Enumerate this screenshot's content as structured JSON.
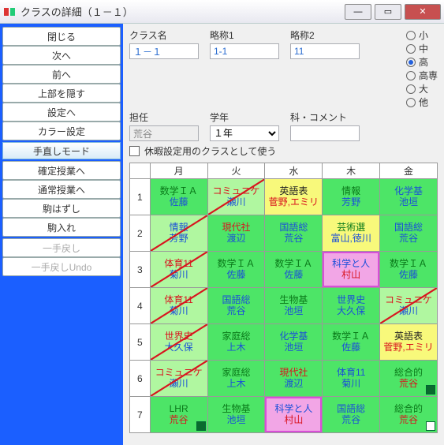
{
  "window": {
    "title": "クラスの詳細（１－１）"
  },
  "sidebar": {
    "buttons": [
      "閉じる",
      "次へ",
      "前へ",
      "上部を隠す",
      "設定へ",
      "カラー設定"
    ],
    "section": "手直しモード",
    "buttons2": [
      "確定授業へ",
      "通常授業へ",
      "駒はずし",
      "駒入れ"
    ],
    "disabled": [
      "一手戻し",
      "一手戻しUndo"
    ]
  },
  "form": {
    "l_class": "クラス名",
    "v_class": "１－１",
    "l_abbr1": "略称1",
    "v_abbr1": "1-1",
    "l_abbr2": "略称2",
    "v_abbr2": "11",
    "l_tannin": "担任",
    "v_tannin": "荒谷",
    "l_grade": "学年",
    "v_grade": "１年",
    "l_ka": "科・コメント",
    "v_ka": ""
  },
  "radios": [
    "小",
    "中",
    "高",
    "高専",
    "大",
    "他"
  ],
  "radio_sel": 2,
  "checkbox": "休暇設定用のクラスとして使う",
  "days": [
    "月",
    "火",
    "水",
    "木",
    "金"
  ],
  "rows": [
    "1",
    "2",
    "3",
    "4",
    "5",
    "6",
    "7"
  ],
  "cells": [
    [
      {
        "s": "数学ＩＡ",
        "t": "佐藤",
        "bg": "g",
        "sc": "subj-g",
        "tc": "tch-b"
      },
      {
        "s": "コミュニケ",
        "t": "瀬川",
        "bg": "lg",
        "sc": "subj-r",
        "tc": "tch-b",
        "d": 1
      },
      {
        "s": "英語表",
        "t": "菅野,エミリ",
        "bg": "y",
        "sc": "subj-k",
        "tc": "tch-r"
      },
      {
        "s": "情報",
        "t": "芳野",
        "bg": "g",
        "sc": "subj-g",
        "tc": "tch-b"
      },
      {
        "s": "化学基",
        "t": "池垣",
        "bg": "g",
        "sc": "subj-b",
        "tc": "tch-b"
      }
    ],
    [
      {
        "s": "情報",
        "t": "芳野",
        "bg": "lg",
        "sc": "subj-b",
        "tc": "tch-b",
        "d": 1
      },
      {
        "s": "現代社",
        "t": "渡辺",
        "bg": "g",
        "sc": "subj-r",
        "tc": "tch-b"
      },
      {
        "s": "国語総",
        "t": "荒谷",
        "bg": "g",
        "sc": "subj-b",
        "tc": "tch-b"
      },
      {
        "s": "芸術選",
        "t": "富山,徳川",
        "bg": "y",
        "sc": "subj-g",
        "tc": "tch-b"
      },
      {
        "s": "国語総",
        "t": "荒谷",
        "bg": "g",
        "sc": "subj-b",
        "tc": "tch-b"
      }
    ],
    [
      {
        "s": "体育11",
        "t": "菊川",
        "bg": "lg",
        "sc": "subj-r",
        "tc": "tch-b",
        "d": 1
      },
      {
        "s": "数学ＩＡ",
        "t": "佐藤",
        "bg": "g",
        "sc": "subj-g",
        "tc": "tch-b"
      },
      {
        "s": "数学ＩＡ",
        "t": "佐藤",
        "bg": "g",
        "sc": "subj-g",
        "tc": "tch-b"
      },
      {
        "s": "科学と人",
        "t": "村山",
        "bg": "p",
        "sc": "subj-b",
        "tc": "tch-r",
        "pb": 1
      },
      {
        "s": "数学ＩＡ",
        "t": "佐藤",
        "bg": "g",
        "sc": "subj-g",
        "tc": "tch-b"
      }
    ],
    [
      {
        "s": "体育11",
        "t": "菊川",
        "bg": "lg",
        "sc": "subj-r",
        "tc": "tch-b",
        "d": 1
      },
      {
        "s": "国語総",
        "t": "荒谷",
        "bg": "g",
        "sc": "subj-b",
        "tc": "tch-b"
      },
      {
        "s": "生物基",
        "t": "池垣",
        "bg": "g",
        "sc": "subj-g",
        "tc": "tch-b"
      },
      {
        "s": "世界史",
        "t": "大久保",
        "bg": "g",
        "sc": "subj-b",
        "tc": "tch-b"
      },
      {
        "s": "コミュニケ",
        "t": "瀬川",
        "bg": "lg",
        "sc": "subj-r",
        "tc": "tch-b",
        "d": 1
      }
    ],
    [
      {
        "s": "世界史",
        "t": "大久保",
        "bg": "lg",
        "sc": "subj-r",
        "tc": "tch-b",
        "d": 1
      },
      {
        "s": "家庭総",
        "t": "上木",
        "bg": "g",
        "sc": "subj-g",
        "tc": "tch-b"
      },
      {
        "s": "化学基",
        "t": "池垣",
        "bg": "g",
        "sc": "subj-b",
        "tc": "tch-b"
      },
      {
        "s": "数学ＩＡ",
        "t": "佐藤",
        "bg": "g",
        "sc": "subj-g",
        "tc": "tch-b"
      },
      {
        "s": "英語表",
        "t": "菅野,エミリ",
        "bg": "y",
        "sc": "subj-k",
        "tc": "tch-r"
      }
    ],
    [
      {
        "s": "コミュニケ",
        "t": "瀬川",
        "bg": "lg",
        "sc": "subj-r",
        "tc": "tch-b",
        "d": 1
      },
      {
        "s": "家庭総",
        "t": "上木",
        "bg": "g",
        "sc": "subj-g",
        "tc": "tch-b"
      },
      {
        "s": "現代社",
        "t": "渡辺",
        "bg": "g",
        "sc": "subj-r",
        "tc": "tch-b"
      },
      {
        "s": "体育11",
        "t": "菊川",
        "bg": "g",
        "sc": "subj-b",
        "tc": "tch-b"
      },
      {
        "s": "総合的",
        "t": "荒谷",
        "bg": "g",
        "sc": "subj-g",
        "tc": "tch-r",
        "sq": "dk"
      }
    ],
    [
      {
        "s": "LHR",
        "t": "荒谷",
        "bg": "g",
        "sc": "subj-g",
        "tc": "tch-r",
        "sq": "dk"
      },
      {
        "s": "生物基",
        "t": "池垣",
        "bg": "g",
        "sc": "subj-g",
        "tc": "tch-b"
      },
      {
        "s": "科学と人",
        "t": "村山",
        "bg": "p",
        "sc": "subj-b",
        "tc": "tch-r",
        "pb": 1
      },
      {
        "s": "国語総",
        "t": "荒谷",
        "bg": "g",
        "sc": "subj-b",
        "tc": "tch-b"
      },
      {
        "s": "総合的",
        "t": "荒谷",
        "bg": "g",
        "sc": "subj-g",
        "tc": "tch-r",
        "sq": "wt"
      }
    ]
  ]
}
